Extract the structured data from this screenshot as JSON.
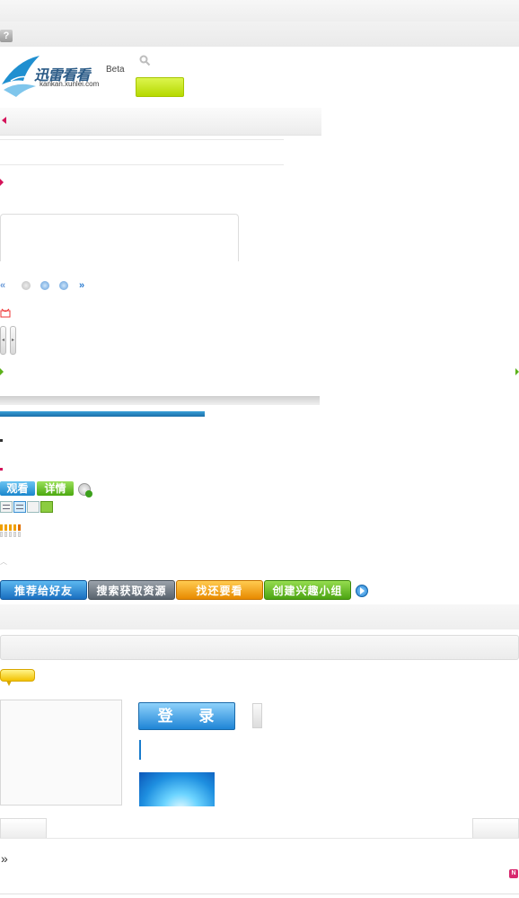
{
  "colors": {
    "accent_green": "#b6d900",
    "accent_red": "#d4145a",
    "accent_blue": "#1a86cc",
    "accent_orange": "#f0a000"
  },
  "header": {
    "help_icon": "?",
    "logo_cn": "迅雷看看",
    "logo_domain": "kankan.xunlei.com",
    "logo_beta": "Beta"
  },
  "actions": {
    "watch": "观看",
    "details": "详情"
  },
  "buttons": {
    "recommend": "推荐给好友",
    "search_resource": "搜索获取资源",
    "find_more": "找还要看",
    "create_group": "创建兴趣小组"
  },
  "login": {
    "label": "登 录"
  },
  "icons": {
    "raquo": "»",
    "new_badge": "N"
  }
}
